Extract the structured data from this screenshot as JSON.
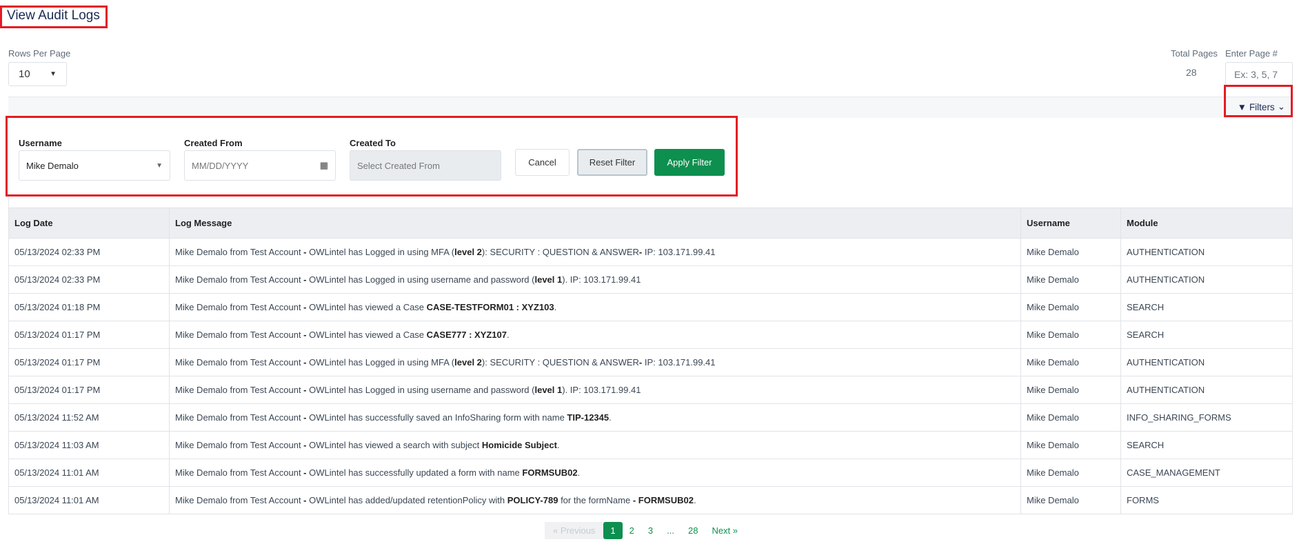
{
  "header": {
    "title": "View Audit Logs"
  },
  "rows_per_page": {
    "label": "Rows Per Page",
    "value": "10"
  },
  "total_pages": {
    "label": "Total Pages",
    "value": "28"
  },
  "page_jump": {
    "label": "Enter Page #",
    "placeholder": "Ex: 3, 5, 7"
  },
  "filters": {
    "toggle_label": "Filters",
    "username_label": "Username",
    "username_value": "Mike Demalo",
    "created_from_label": "Created From",
    "created_from_placeholder": "MM/DD/YYYY",
    "created_to_label": "Created To",
    "created_to_placeholder": "Select Created From",
    "cancel": "Cancel",
    "reset": "Reset Filter",
    "apply": "Apply Filter"
  },
  "colors": {
    "accent": "#0d8f4f",
    "title": "#1c2a55",
    "highlight": "#e31b23"
  },
  "table": {
    "columns": [
      "Log Date",
      "Log Message",
      "Username",
      "Module"
    ],
    "rows": [
      {
        "date": "05/13/2024 02:33 PM",
        "msg": [
          [
            "Mike Demalo from Test Account ",
            0
          ],
          [
            "-",
            1
          ],
          [
            " OWLintel has Logged in using MFA (",
            0
          ],
          [
            "level 2",
            1
          ],
          [
            "): SECURITY : QUESTION & ANSWER",
            0
          ],
          [
            "-",
            1
          ],
          [
            " IP: 103.171.99.41",
            0
          ]
        ],
        "user": "Mike Demalo",
        "module": "AUTHENTICATION"
      },
      {
        "date": "05/13/2024 02:33 PM",
        "msg": [
          [
            "Mike Demalo from Test Account ",
            0
          ],
          [
            "-",
            1
          ],
          [
            " OWLintel has Logged in using username and password (",
            0
          ],
          [
            "level 1",
            1
          ],
          [
            "). IP: 103.171.99.41",
            0
          ]
        ],
        "user": "Mike Demalo",
        "module": "AUTHENTICATION"
      },
      {
        "date": "05/13/2024 01:18 PM",
        "msg": [
          [
            "Mike Demalo from Test Account ",
            0
          ],
          [
            "-",
            1
          ],
          [
            " OWLintel has viewed a Case ",
            0
          ],
          [
            "CASE-TESTFORM01 : XYZ103",
            1
          ],
          [
            ".",
            0
          ]
        ],
        "user": "Mike Demalo",
        "module": "SEARCH"
      },
      {
        "date": "05/13/2024 01:17 PM",
        "msg": [
          [
            "Mike Demalo from Test Account ",
            0
          ],
          [
            "-",
            1
          ],
          [
            " OWLintel has viewed a Case ",
            0
          ],
          [
            "CASE777 : XYZ107",
            1
          ],
          [
            ".",
            0
          ]
        ],
        "user": "Mike Demalo",
        "module": "SEARCH"
      },
      {
        "date": "05/13/2024 01:17 PM",
        "msg": [
          [
            "Mike Demalo from Test Account ",
            0
          ],
          [
            "-",
            1
          ],
          [
            " OWLintel has Logged in using MFA (",
            0
          ],
          [
            "level 2",
            1
          ],
          [
            "): SECURITY : QUESTION & ANSWER",
            0
          ],
          [
            "-",
            1
          ],
          [
            " IP: 103.171.99.41",
            0
          ]
        ],
        "user": "Mike Demalo",
        "module": "AUTHENTICATION"
      },
      {
        "date": "05/13/2024 01:17 PM",
        "msg": [
          [
            "Mike Demalo from Test Account ",
            0
          ],
          [
            "-",
            1
          ],
          [
            " OWLintel has Logged in using username and password (",
            0
          ],
          [
            "level 1",
            1
          ],
          [
            "). IP: 103.171.99.41",
            0
          ]
        ],
        "user": "Mike Demalo",
        "module": "AUTHENTICATION"
      },
      {
        "date": "05/13/2024 11:52 AM",
        "msg": [
          [
            "Mike Demalo from Test Account ",
            0
          ],
          [
            "-",
            1
          ],
          [
            " OWLintel has successfully saved an InfoSharing form with name ",
            0
          ],
          [
            "TIP-12345",
            1
          ],
          [
            ".",
            0
          ]
        ],
        "user": "Mike Demalo",
        "module": "INFO_SHARING_FORMS"
      },
      {
        "date": "05/13/2024 11:03 AM",
        "msg": [
          [
            "Mike Demalo from Test Account ",
            0
          ],
          [
            "-",
            1
          ],
          [
            " OWLintel has viewed a search with subject ",
            0
          ],
          [
            "Homicide Subject",
            1
          ],
          [
            ".",
            0
          ]
        ],
        "user": "Mike Demalo",
        "module": "SEARCH"
      },
      {
        "date": "05/13/2024 11:01 AM",
        "msg": [
          [
            "Mike Demalo from Test Account ",
            0
          ],
          [
            "-",
            1
          ],
          [
            " OWLintel has successfully updated a form with name ",
            0
          ],
          [
            "FORMSUB02",
            1
          ],
          [
            ".",
            0
          ]
        ],
        "user": "Mike Demalo",
        "module": "CASE_MANAGEMENT"
      },
      {
        "date": "05/13/2024 11:01 AM",
        "msg": [
          [
            "Mike Demalo from Test Account ",
            0
          ],
          [
            "-",
            1
          ],
          [
            " OWLintel has added/updated retentionPolicy with ",
            0
          ],
          [
            "POLICY-789",
            1
          ],
          [
            " for the formName ",
            0
          ],
          [
            "- FORMSUB02",
            1
          ],
          [
            ".",
            0
          ]
        ],
        "user": "Mike Demalo",
        "module": "FORMS"
      }
    ]
  },
  "pagination": {
    "prev": "« Previous",
    "pages": [
      "1",
      "2",
      "3",
      "...",
      "28"
    ],
    "current": "1",
    "next": "Next »"
  }
}
